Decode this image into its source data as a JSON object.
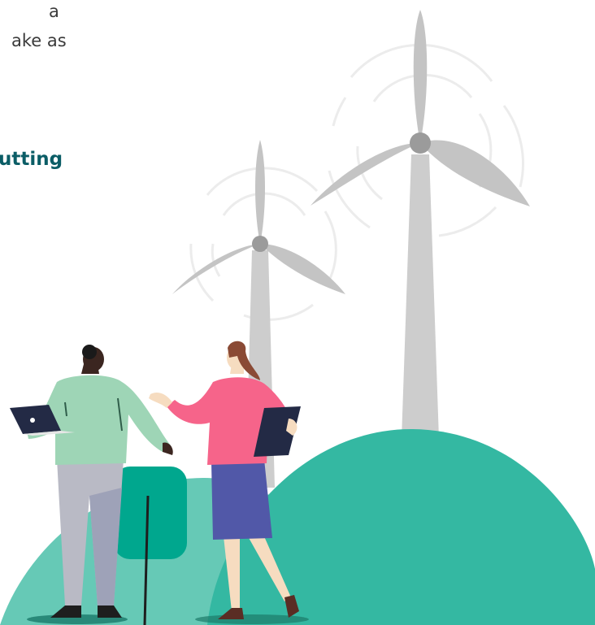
{
  "text": {
    "line1": "a",
    "line2": "ake as",
    "heading_fragment": "utting"
  },
  "colors": {
    "hill_big": "#34b8a2",
    "hill_small": "#66c9b6",
    "bush": "#00a78e",
    "turbine": "#cdcdcd",
    "turbine_hub": "#9b9b9b",
    "heading": "#0b5d66"
  },
  "illustration": {
    "objects": [
      "wind-turbine",
      "wind-turbine",
      "person-with-laptop",
      "person-with-tablet",
      "hills",
      "bush"
    ]
  }
}
